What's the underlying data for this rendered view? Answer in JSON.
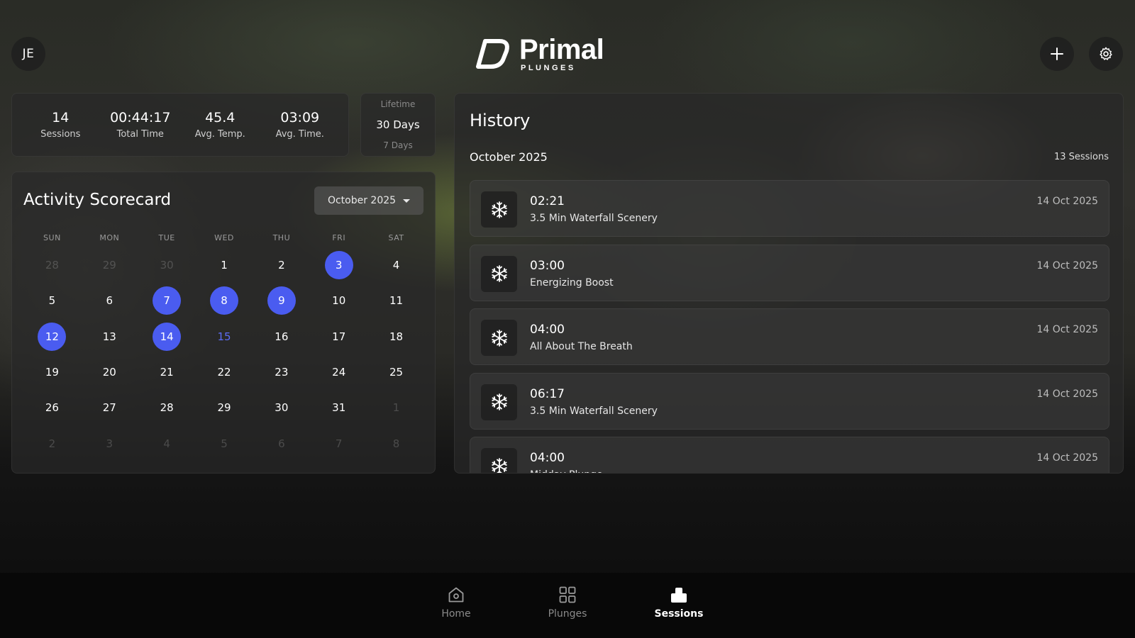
{
  "user": {
    "initials": "JE"
  },
  "brand": {
    "name": "Primal",
    "sub": "PLUNGES"
  },
  "header": {
    "add_icon": "plus-icon",
    "settings_icon": "gear-icon"
  },
  "stats": [
    {
      "value": "14",
      "label": "Sessions"
    },
    {
      "value": "00:44:17",
      "label": "Total Time"
    },
    {
      "value": "45.4",
      "label": "Avg. Temp."
    },
    {
      "value": "03:09",
      "label": "Avg. Time."
    }
  ],
  "range": {
    "options": [
      "Lifetime",
      "30 Days",
      "7 Days"
    ],
    "selected": "30 Days"
  },
  "calendar": {
    "title": "Activity Scorecard",
    "month_label": "October 2025",
    "weekdays": [
      "SUN",
      "MON",
      "TUE",
      "WED",
      "THU",
      "FRI",
      "SAT"
    ],
    "days": [
      {
        "d": "28",
        "other": true
      },
      {
        "d": "29",
        "other": true
      },
      {
        "d": "30",
        "other": true
      },
      {
        "d": "1"
      },
      {
        "d": "2"
      },
      {
        "d": "3",
        "active": true
      },
      {
        "d": "4"
      },
      {
        "d": "5"
      },
      {
        "d": "6"
      },
      {
        "d": "7",
        "active": true
      },
      {
        "d": "8",
        "active": true
      },
      {
        "d": "9",
        "active": true
      },
      {
        "d": "10"
      },
      {
        "d": "11"
      },
      {
        "d": "12",
        "active": true
      },
      {
        "d": "13"
      },
      {
        "d": "14",
        "active": true
      },
      {
        "d": "15",
        "today": true
      },
      {
        "d": "16"
      },
      {
        "d": "17"
      },
      {
        "d": "18"
      },
      {
        "d": "19"
      },
      {
        "d": "20"
      },
      {
        "d": "21"
      },
      {
        "d": "22"
      },
      {
        "d": "23"
      },
      {
        "d": "24"
      },
      {
        "d": "25"
      },
      {
        "d": "26"
      },
      {
        "d": "27"
      },
      {
        "d": "28"
      },
      {
        "d": "29"
      },
      {
        "d": "30"
      },
      {
        "d": "31"
      },
      {
        "d": "1",
        "other": true
      },
      {
        "d": "2",
        "other": true
      },
      {
        "d": "3",
        "other": true
      },
      {
        "d": "4",
        "other": true
      },
      {
        "d": "5",
        "other": true
      },
      {
        "d": "6",
        "other": true
      },
      {
        "d": "7",
        "other": true
      },
      {
        "d": "8",
        "other": true
      }
    ],
    "active_color": "#4a5cf0",
    "today_color": "#5b6cf5"
  },
  "history": {
    "title": "History",
    "month": "October 2025",
    "count": "13 Sessions",
    "sessions": [
      {
        "duration": "02:21",
        "name": "3.5 Min Waterfall Scenery",
        "date": "14 Oct 2025",
        "icon": "snowflake-icon"
      },
      {
        "duration": "03:00",
        "name": "Energizing Boost",
        "date": "14 Oct 2025",
        "icon": "snowflake-icon"
      },
      {
        "duration": "04:00",
        "name": "All About The Breath",
        "date": "14 Oct 2025",
        "icon": "snowflake-icon"
      },
      {
        "duration": "06:17",
        "name": "3.5 Min Waterfall Scenery",
        "date": "14 Oct 2025",
        "icon": "snowflake-icon"
      },
      {
        "duration": "04:00",
        "name": "Midday Plunge",
        "date": "14 Oct 2025",
        "icon": "snowflake-icon"
      }
    ]
  },
  "nav": {
    "items": [
      {
        "label": "Home",
        "icon": "home-icon"
      },
      {
        "label": "Plunges",
        "icon": "grid-icon"
      },
      {
        "label": "Sessions",
        "icon": "sessions-icon"
      }
    ],
    "selected": "Sessions"
  }
}
